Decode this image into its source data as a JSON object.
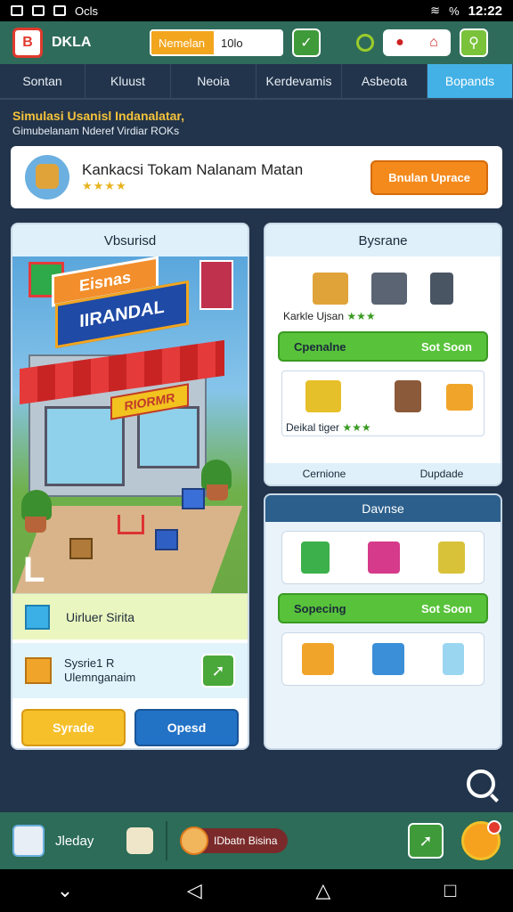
{
  "status_bar": {
    "left_text": "Ocls",
    "battery": "%",
    "time": "12:22"
  },
  "header": {
    "logo_letter": "B",
    "app_name": "DKLA",
    "field_label": "Nemelan",
    "field_value": "10lo",
    "check_icon": "check-icon",
    "search_icon": "search-icon"
  },
  "tabs": [
    {
      "label": "Sontan",
      "active": false
    },
    {
      "label": "Kluust",
      "active": false
    },
    {
      "label": "Neoia",
      "active": false
    },
    {
      "label": "Kerdevamis",
      "active": false
    },
    {
      "label": "Asbeota",
      "active": false
    },
    {
      "label": "Bopands",
      "active": true
    }
  ],
  "subtitle": {
    "line1": "Simulasi Usanisl Indanalatar,",
    "line2": "Gimubelanam Nderef Virdiar ROKs"
  },
  "banner": {
    "title": "Kankacsi Tokam Nalanam Matan",
    "stars": "★★★★",
    "upgrade_label": "Bnulan Uprace"
  },
  "left_panel": {
    "title": "Vbsurisd",
    "scene": {
      "sign_top": "Eisnas",
      "sign_main": "IIRANDAL",
      "sign_store": "RIORMR",
      "corner_letter": "L"
    },
    "row1_label": "Uirluer Sirita",
    "row2_line1": "Sysrie1 R",
    "row2_line2": "Ulemnganaim",
    "btn_yellow": "Syrade",
    "btn_blue": "Opesd"
  },
  "right_panel1": {
    "title": "Bysrane",
    "row1_label": "Karkle Ujsan",
    "row1_stars": "★★★",
    "bar_label": "Cpenalne",
    "bar_value": "Sot Soon",
    "row2_label": "Deikal tiger",
    "row2_stars": "★★★",
    "footer_left": "Cernione",
    "footer_right": "Dupdade"
  },
  "right_panel2": {
    "title": "Davnse",
    "bar_label": "Sopecing",
    "bar_value": "Sot Soon"
  },
  "bottom_bar": {
    "left_label": "Jleday",
    "user_label": "IDbatn Bisina"
  },
  "colors": {
    "header_bg": "#2f6b5a",
    "tab_active": "#43b1e6",
    "accent_orange": "#f48a1c",
    "accent_green": "#58c33a",
    "accent_blue": "#2272c6"
  }
}
